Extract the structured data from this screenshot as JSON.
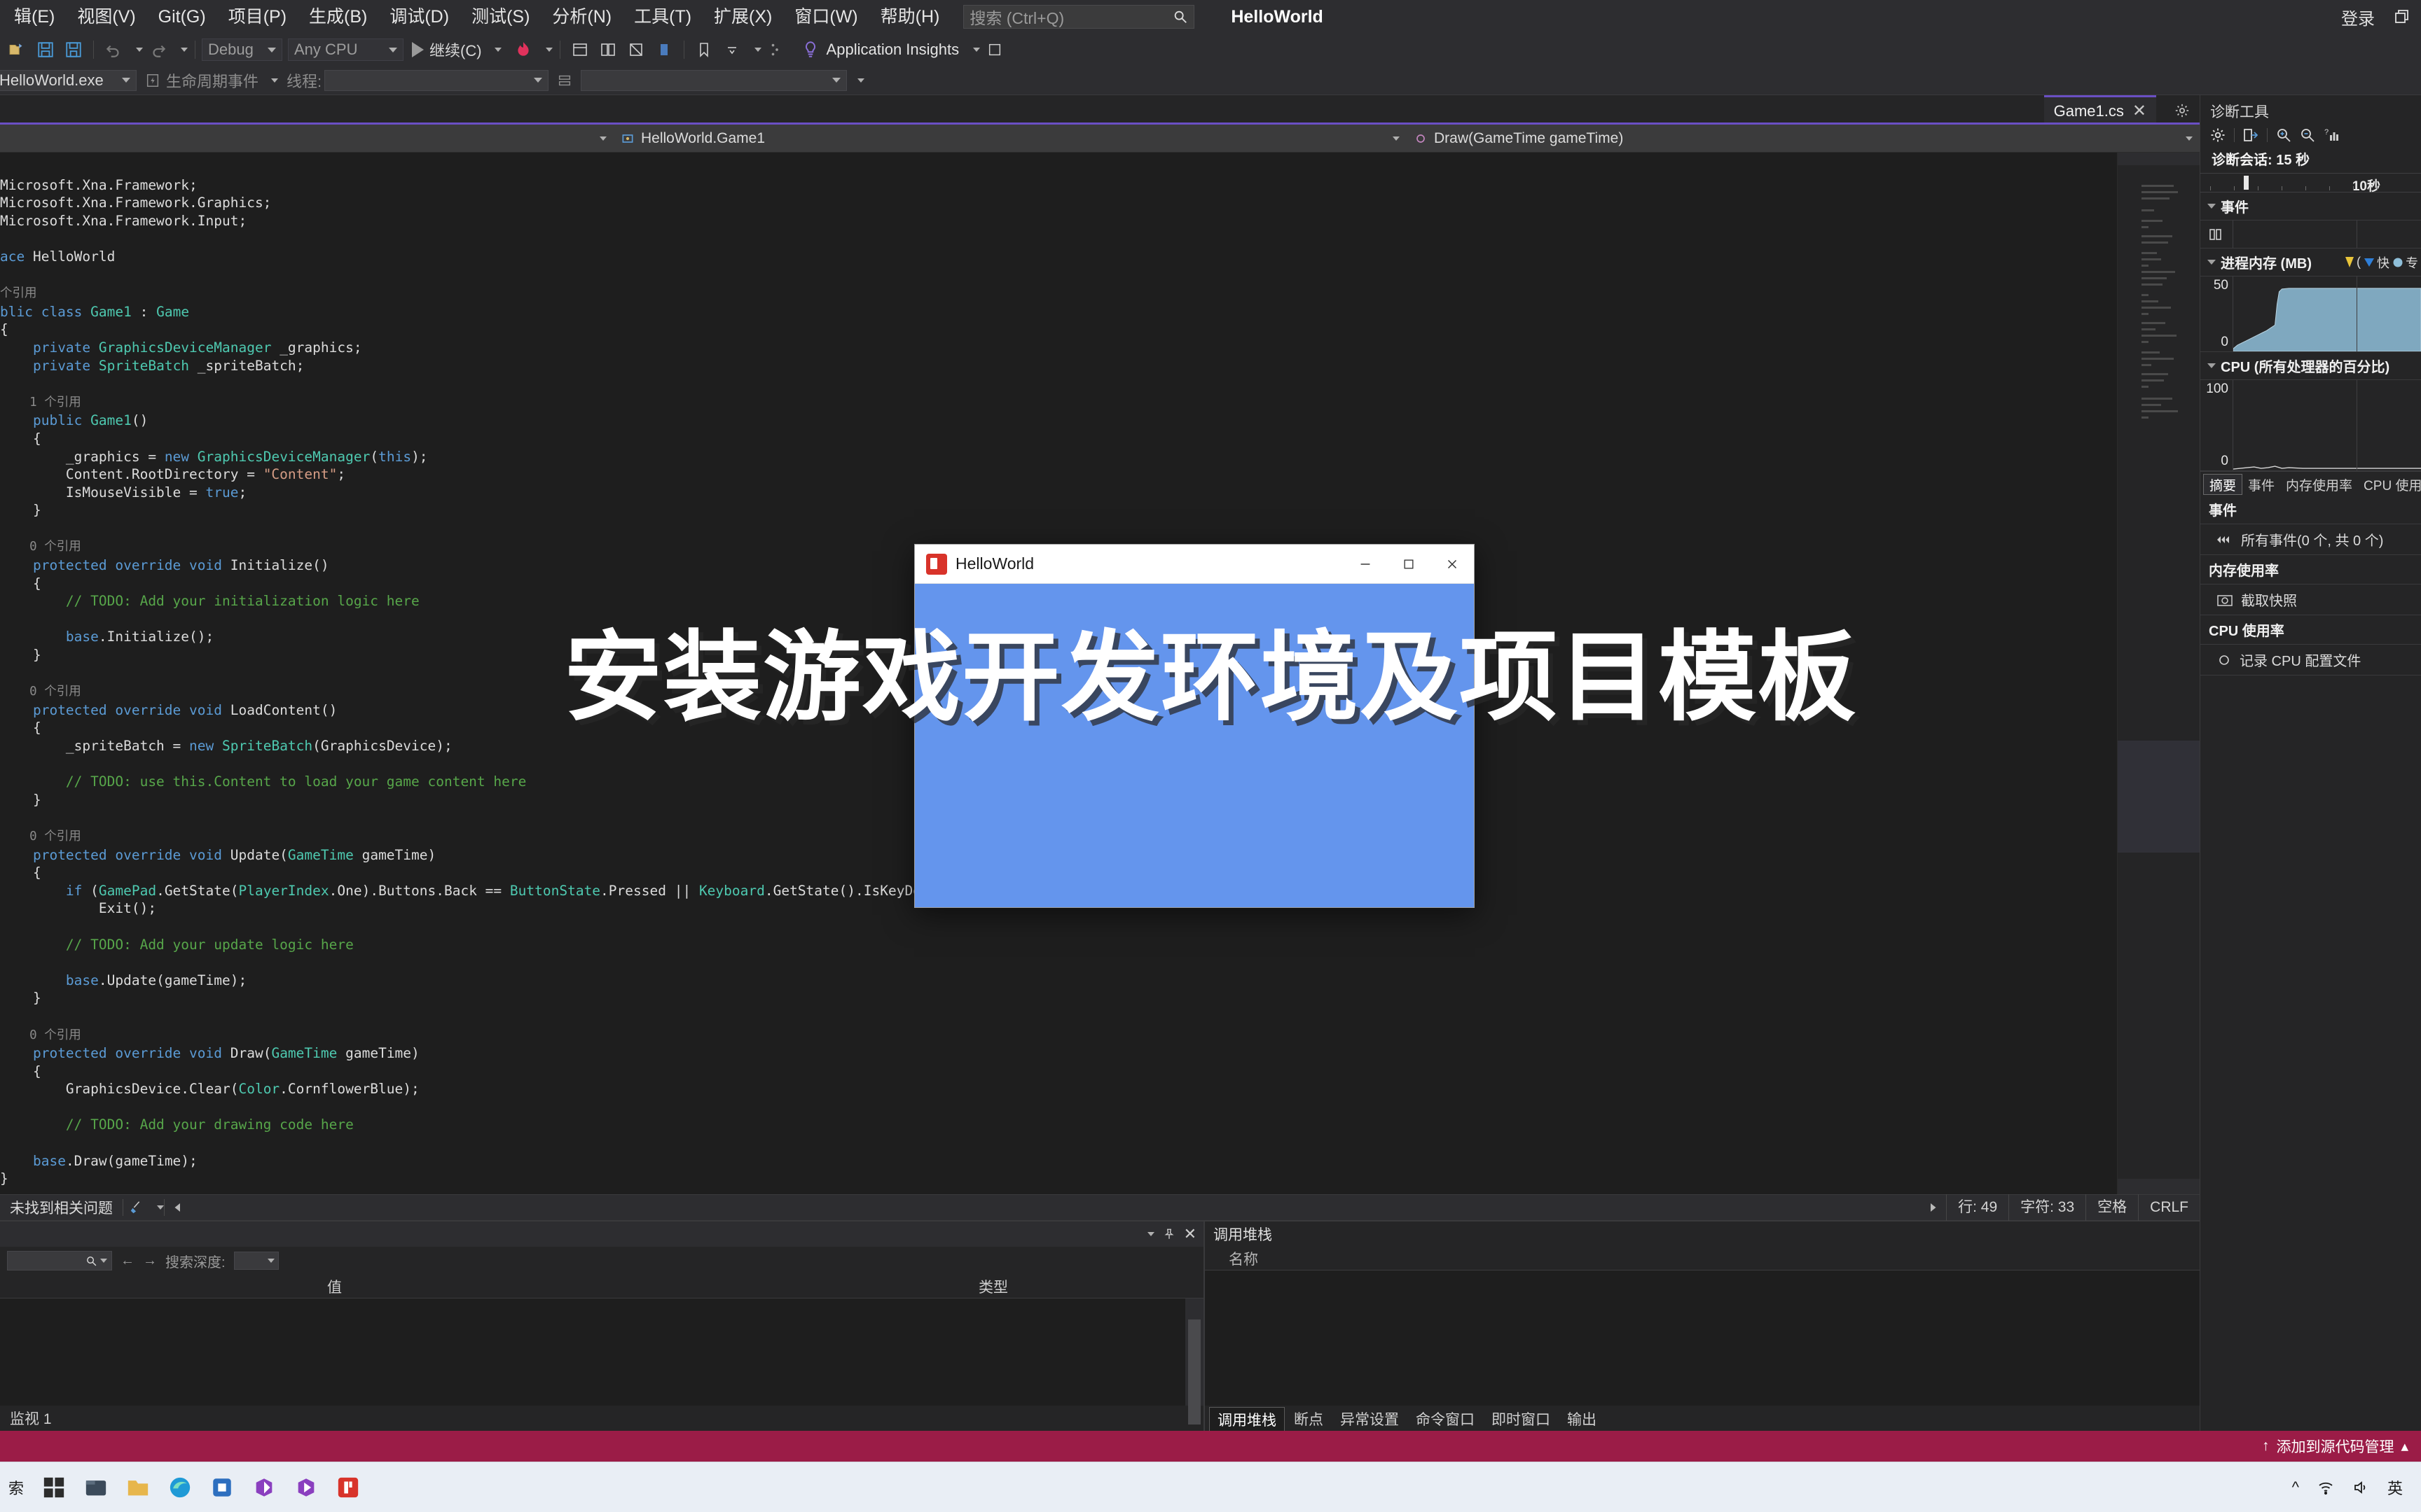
{
  "menu": {
    "items": [
      "辑(E)",
      "视图(V)",
      "Git(G)",
      "项目(P)",
      "生成(B)",
      "调试(D)",
      "测试(S)",
      "分析(N)",
      "工具(T)",
      "扩展(X)",
      "窗口(W)",
      "帮助(H)"
    ],
    "search_placeholder": "搜索 (Ctrl+Q)",
    "search_icon": "search-icon",
    "app_title": "HelloWorld",
    "login_label": "登录",
    "window_icon": "maximize-restore-icon"
  },
  "toolbar": {
    "open_icon": "open-folder-icon",
    "save_icon": "save-icon",
    "save_all_icon": "save-all-icon",
    "undo_icon": "undo-arrow-icon",
    "redo_icon": "redo-arrow-icon",
    "config": "Debug",
    "platform": "Any CPU",
    "continue_label": "继续(C)",
    "play_icon": "play-triangle-icon",
    "hot_reload_icon": "hot-reload-flame-icon",
    "app_insights": "Application Insights",
    "bulb_icon": "lightbulb-icon"
  },
  "debugbar": {
    "process": "HelloWorld.exe",
    "lifecycle_label": "生命周期事件",
    "lifecycle_icon": "lifecycle-events-icon",
    "thread_label": "线程:",
    "thread_value": ""
  },
  "tab": {
    "filename": "Game1.cs",
    "close_icon": "close-icon",
    "pin_icon": "pin-icon",
    "settings_icon": "gear-icon"
  },
  "breadcrumb": {
    "project": "",
    "type": "HelloWorld.Game1",
    "member": "Draw(GameTime gameTime)",
    "type_icon": "class-icon",
    "member_icon": "method-icon"
  },
  "editor": {
    "code_lines": [
      {
        "indent": 0,
        "ref": "",
        "html": "<span class=\"c0\">Microsoft.Xna.Framework;</span>"
      },
      {
        "indent": 0,
        "ref": "",
        "html": "Microsoft.Xna.Framework.Graphics;"
      },
      {
        "indent": 0,
        "ref": "",
        "html": "Microsoft.Xna.Framework.Input;"
      }
    ],
    "text": "Microsoft.Xna.Framework;\nMicrosoft.Xna.Framework.Graphics;\nMicrosoft.Xna.Framework.Input;\n\nace HelloWorld\n\n个引用\nblic class Game1 : Game\n{\n    private GraphicsDeviceManager _graphics;\n    private SpriteBatch _spriteBatch;\n\n    1 个引用\n    public Game1()\n    {\n        _graphics = new GraphicsDeviceManager(this);\n        Content.RootDirectory = \"Content\";\n        IsMouseVisible = true;\n    }\n\n    0 个引用\n    protected override void Initialize()\n    {\n        // TODO: Add your initialization logic here\n\n        base.Initialize();\n    }\n\n    0 个引用\n    protected override void LoadContent()\n    {\n        _spriteBatch = new SpriteBatch(GraphicsDevice);\n\n        // TODO: use this.Content to load your game content here\n    }\n\n    0 个引用\n    protected override void Update(GameTime gameTime)\n    {\n        if (GamePad.GetState(PlayerIndex.One).Buttons.Back == ButtonState.Pressed || Keyboard.GetState().IsKeyDown(Keys.Escape))\n            Exit();\n\n        // TODO: Add your update logic here\n\n        base.Update(gameTime);\n    }\n\n    0 个引用\n    protected override void Draw(GameTime gameTime)\n    {\n        GraphicsDevice.Clear(Color.CornflowerBlue);\n\n        // TODO: Add your drawing code here\n\n        base.Draw(gameTime);\n    }\n}",
    "ref_0": "0 个引用",
    "ref_1": "1 个引用",
    "ref_n": "个引用"
  },
  "errorbar": {
    "message": "未找到相关问题",
    "broom_icon": "broom-icon",
    "nav_icon": "collapse-left-icon"
  },
  "status": {
    "line_label": "行: 49",
    "col_label": "字符: 33",
    "indent": "空格",
    "eol": "CRLF"
  },
  "watch": {
    "title": "监视 1",
    "search_placeholder": "",
    "search_icon": "search-icon",
    "prev_icon": "arrow-left-icon",
    "next_icon": "arrow-right-icon",
    "depth_label": "搜索深度:",
    "depth_value": "",
    "columns": [
      "",
      "值",
      "类型"
    ],
    "rows": [],
    "pin_icon": "pin-icon",
    "close_icon": "close-icon",
    "caret_icon": "chevron-down-icon"
  },
  "callstack": {
    "title": "调用堆栈",
    "column": "名称",
    "rows": [],
    "tabs": [
      "调用堆栈",
      "断点",
      "异常设置",
      "命令窗口",
      "即时窗口",
      "输出"
    ],
    "active_tab": "调用堆栈"
  },
  "diagnostics": {
    "title": "诊断工具",
    "tools": [
      "gear-icon",
      "export-icon",
      "zoom-in-icon",
      "zoom-out-icon",
      "chart-help-icon"
    ],
    "session_label": "诊断会话: 15 秒",
    "ruler_label": "10秒",
    "events_section": "事件",
    "memory_section": "进程内存 (MB)",
    "memory_legend": [
      {
        "icon": "gc-marker-yellow",
        "label": "("
      },
      {
        "icon": "snapshot-marker-blue",
        "label": "快"
      },
      {
        "icon": "private-bytes-circle",
        "label": "专"
      }
    ],
    "memory_axis_top": "50",
    "memory_axis_bottom": "0",
    "cpu_section": "CPU (所有处理器的百分比)",
    "cpu_axis_top": "100",
    "cpu_axis_bottom": "0",
    "tabs": [
      "摘要",
      "事件",
      "内存使用率",
      "CPU 使用"
    ],
    "active_tab": "摘要",
    "summary": [
      {
        "kind": "header",
        "label": "事件"
      },
      {
        "kind": "item",
        "icon": "events-icon",
        "label": "所有事件(0 个, 共 0 个)"
      },
      {
        "kind": "header",
        "label": "内存使用率"
      },
      {
        "kind": "item",
        "icon": "camera-icon",
        "label": "截取快照"
      },
      {
        "kind": "header",
        "label": "CPU 使用率"
      },
      {
        "kind": "item",
        "icon": "record-circle-icon",
        "label": "记录 CPU 配置文件"
      }
    ]
  },
  "chart_data": {
    "type": "area",
    "title": "进程内存 (MB)",
    "ylabel": "MB",
    "ylim": [
      0,
      50
    ],
    "x": [
      0,
      1,
      2,
      3,
      4,
      5,
      6,
      7,
      8,
      9,
      10,
      11,
      12,
      13,
      14,
      15
    ],
    "series": [
      {
        "name": "专用字节",
        "values": [
          2,
          3,
          5,
          6,
          7,
          8,
          9,
          10,
          41,
          43,
          43,
          43,
          43,
          43,
          43,
          43
        ],
        "color": "#7fa8bf"
      }
    ],
    "second_chart": {
      "type": "line",
      "title": "CPU (所有处理器的百分比)",
      "ylabel": "%",
      "ylim": [
        0,
        100
      ],
      "x": [
        0,
        1,
        2,
        3,
        4,
        5,
        6,
        7,
        8,
        9,
        10,
        11,
        12,
        13,
        14,
        15
      ],
      "values": [
        1,
        2,
        1,
        3,
        2,
        1,
        1,
        2,
        1,
        1,
        1,
        1,
        1,
        1,
        1,
        1
      ],
      "color": "#d0d0d0"
    }
  },
  "gamewindow": {
    "title": "HelloWorld",
    "icon": "monogame-icon",
    "minimize_icon": "minimize-icon",
    "maximize_icon": "maximize-icon",
    "close_icon": "close-icon",
    "canvas_color": "#6495ED"
  },
  "overlay": {
    "headline": "安装游戏开发环境及项目模板"
  },
  "footer": {
    "add_to_source": "添加到源代码管理",
    "up_icon": "arrow-up-icon",
    "caret_icon": "chevron-up-icon"
  },
  "taskbar": {
    "start_label": "索",
    "icons": [
      "windows-start-icon",
      "file-explorer-icon",
      "folder-icon",
      "edge-icon",
      "store-icon",
      "vs-installer-icon",
      "vs-code-icon",
      "monogame-icon"
    ],
    "tray": [
      "^",
      "network-icon",
      "volume-icon",
      "英"
    ]
  },
  "colors": {
    "accent_purple": "#6a4fc4",
    "cornflower_blue": "#6495ED",
    "footer_magenta": "#9b1c47",
    "editor_bg": "#1e1e1e",
    "chrome_bg": "#2d2d30"
  }
}
